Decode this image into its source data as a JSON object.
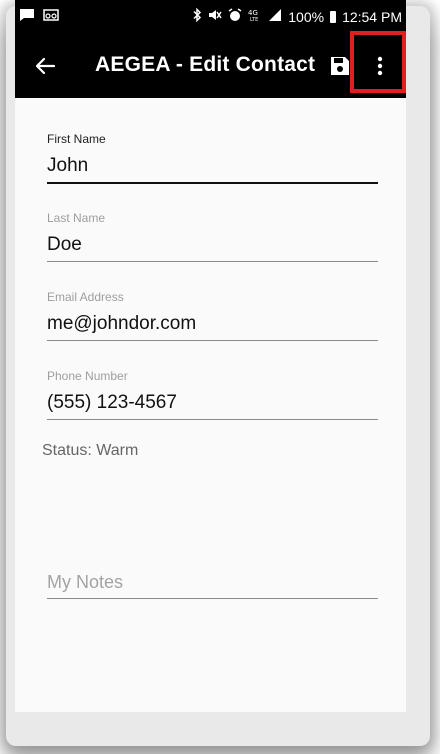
{
  "status_bar": {
    "left_icons": [
      "message-icon",
      "voicemail-icon"
    ],
    "right_icons": [
      "bluetooth-icon",
      "mute-icon",
      "alarm-icon",
      "lte-icon",
      "signal-icon"
    ],
    "battery": "100%",
    "time": "12:54 PM"
  },
  "app_bar": {
    "title": "AEGEA - Edit Contact",
    "back_icon": "arrow-left-icon",
    "save_icon": "floppy-disk-icon",
    "menu_icon": "more-vertical-icon"
  },
  "form": {
    "first_name": {
      "label": "First Name",
      "value": "John"
    },
    "last_name": {
      "label": "Last Name",
      "value": "Doe"
    },
    "email": {
      "label": "Email Address",
      "value": "me@johndor.com"
    },
    "phone": {
      "label": "Phone Number",
      "value": "(555) 123-4567"
    },
    "status": "Status: Warm",
    "notes": {
      "placeholder": "My Notes"
    }
  },
  "colors": {
    "app_bar_bg": "#000000",
    "highlight": "#e01f1f",
    "screen_bg": "#fafafa"
  }
}
